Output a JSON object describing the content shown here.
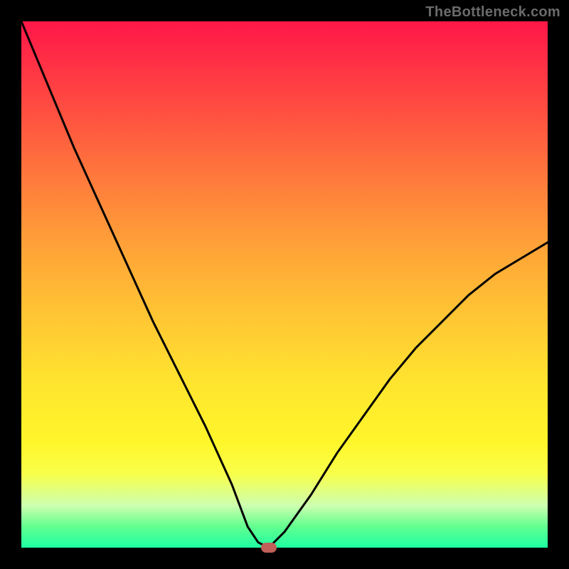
{
  "watermark": "TheBottleneck.com",
  "chart_data": {
    "type": "line",
    "title": "",
    "xlabel": "",
    "ylabel": "",
    "xlim": [
      0,
      100
    ],
    "ylim": [
      0,
      100
    ],
    "grid": false,
    "background_gradient": {
      "direction": "vertical",
      "stops": [
        {
          "pos": 0,
          "color": "#ff1748"
        },
        {
          "pos": 18,
          "color": "#ff5240"
        },
        {
          "pos": 42,
          "color": "#ffa038"
        },
        {
          "pos": 68,
          "color": "#ffe32f"
        },
        {
          "pos": 86,
          "color": "#f8ff4a"
        },
        {
          "pos": 96,
          "color": "#62ff8f"
        },
        {
          "pos": 100,
          "color": "#1dffa2"
        }
      ]
    },
    "series": [
      {
        "name": "bottleneck_curve",
        "x": [
          0,
          5,
          10,
          15,
          20,
          25,
          30,
          35,
          40,
          43,
          45,
          47,
          50,
          55,
          60,
          65,
          70,
          75,
          80,
          85,
          90,
          95,
          100
        ],
        "y": [
          100,
          88,
          76,
          65,
          54,
          43,
          33,
          23,
          12,
          4,
          1,
          0,
          3,
          10,
          18,
          25,
          32,
          38,
          43,
          48,
          52,
          55,
          58
        ]
      }
    ],
    "marker": {
      "x": 47,
      "y": 0,
      "color": "#c06058",
      "shape": "pill"
    }
  }
}
